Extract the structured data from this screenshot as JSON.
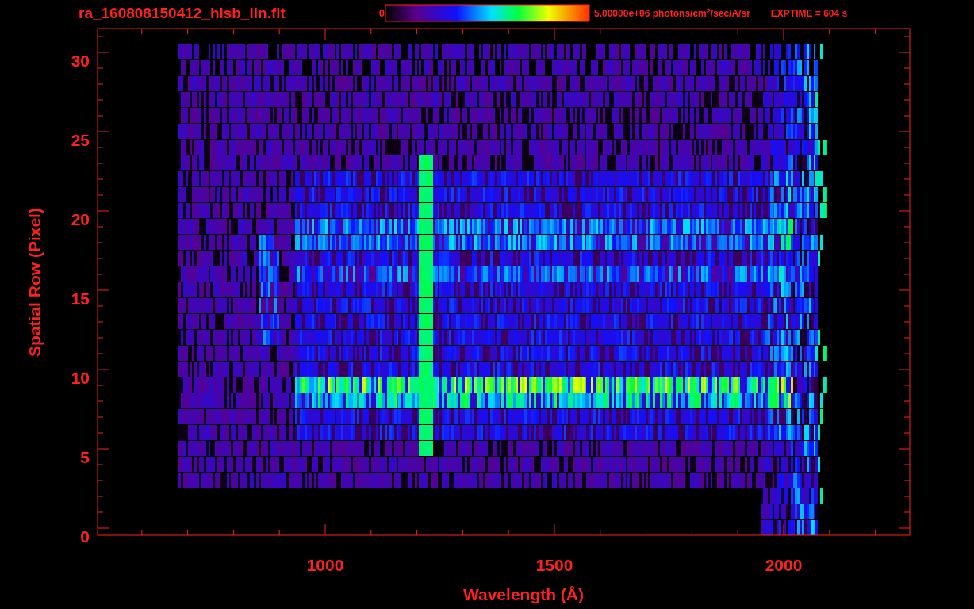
{
  "title": "ra_160808150412_hisb_lin.fit",
  "colorbar": {
    "min_label": "0",
    "max_label": "5.00000e+06 photons/cm$^{2}$/sec/A/sr"
  },
  "exposure": "EXPTIME = 604 s",
  "plot": {
    "xlabel": "Wavelength (Å)",
    "ylabel": "Spatial Row (Pixel)",
    "xticks": [
      "1000",
      "1500",
      "2000"
    ],
    "yticks": [
      "30",
      "25",
      "20",
      "15",
      "10",
      "5",
      "0"
    ]
  }
}
